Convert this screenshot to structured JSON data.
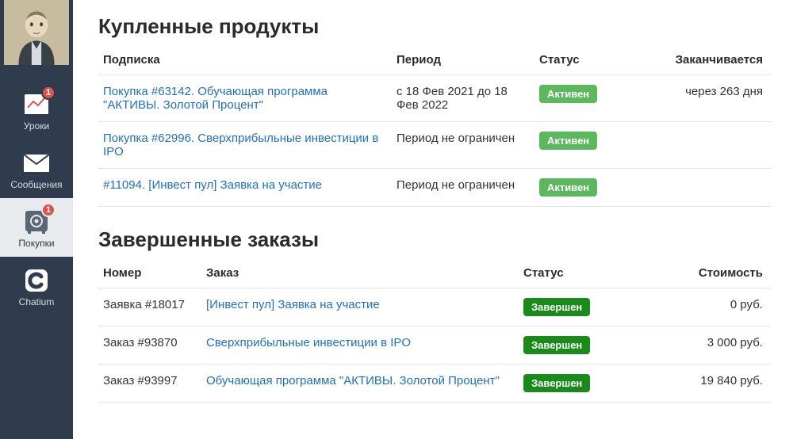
{
  "sidebar": {
    "items": [
      {
        "label": "Уроки",
        "badge": "1"
      },
      {
        "label": "Сообщения"
      },
      {
        "label": "Покупки",
        "badge": "1"
      },
      {
        "label": "Chatium"
      }
    ]
  },
  "products": {
    "title": "Купленные продукты",
    "headers": {
      "subscription": "Подписка",
      "period": "Период",
      "status": "Статус",
      "ends": "Заканчивается"
    },
    "status_active": "Активен",
    "rows": [
      {
        "name": "Покупка #63142. Обучающая программа \"АКТИВЫ. Золотой Процент\"",
        "period": "с 18 Фев 2021 до 18 Фев 2022",
        "ends": "через 263 дня"
      },
      {
        "name": "Покупка #62996. Сверхприбыльные инвестиции в IPO",
        "period": "Период не ограничен",
        "ends": ""
      },
      {
        "name": "#11094. [Инвест пул] Заявка на участие",
        "period": "Период не ограничен",
        "ends": ""
      }
    ]
  },
  "orders": {
    "title": "Завершенные заказы",
    "headers": {
      "number": "Номер",
      "order": "Заказ",
      "status": "Статус",
      "cost": "Стоимость"
    },
    "status_done": "Завершен",
    "rows": [
      {
        "number": "Заявка #18017",
        "name": "[Инвест пул] Заявка на участие",
        "cost": "0 руб."
      },
      {
        "number": "Заказ #93870",
        "name": "Сверхприбыльные инвестиции в IPO",
        "cost": "3 000 руб."
      },
      {
        "number": "Заказ #93997",
        "name": "Обучающая программа \"АКТИВЫ. Золотой Процент\"",
        "cost": "19 840 руб."
      }
    ]
  }
}
